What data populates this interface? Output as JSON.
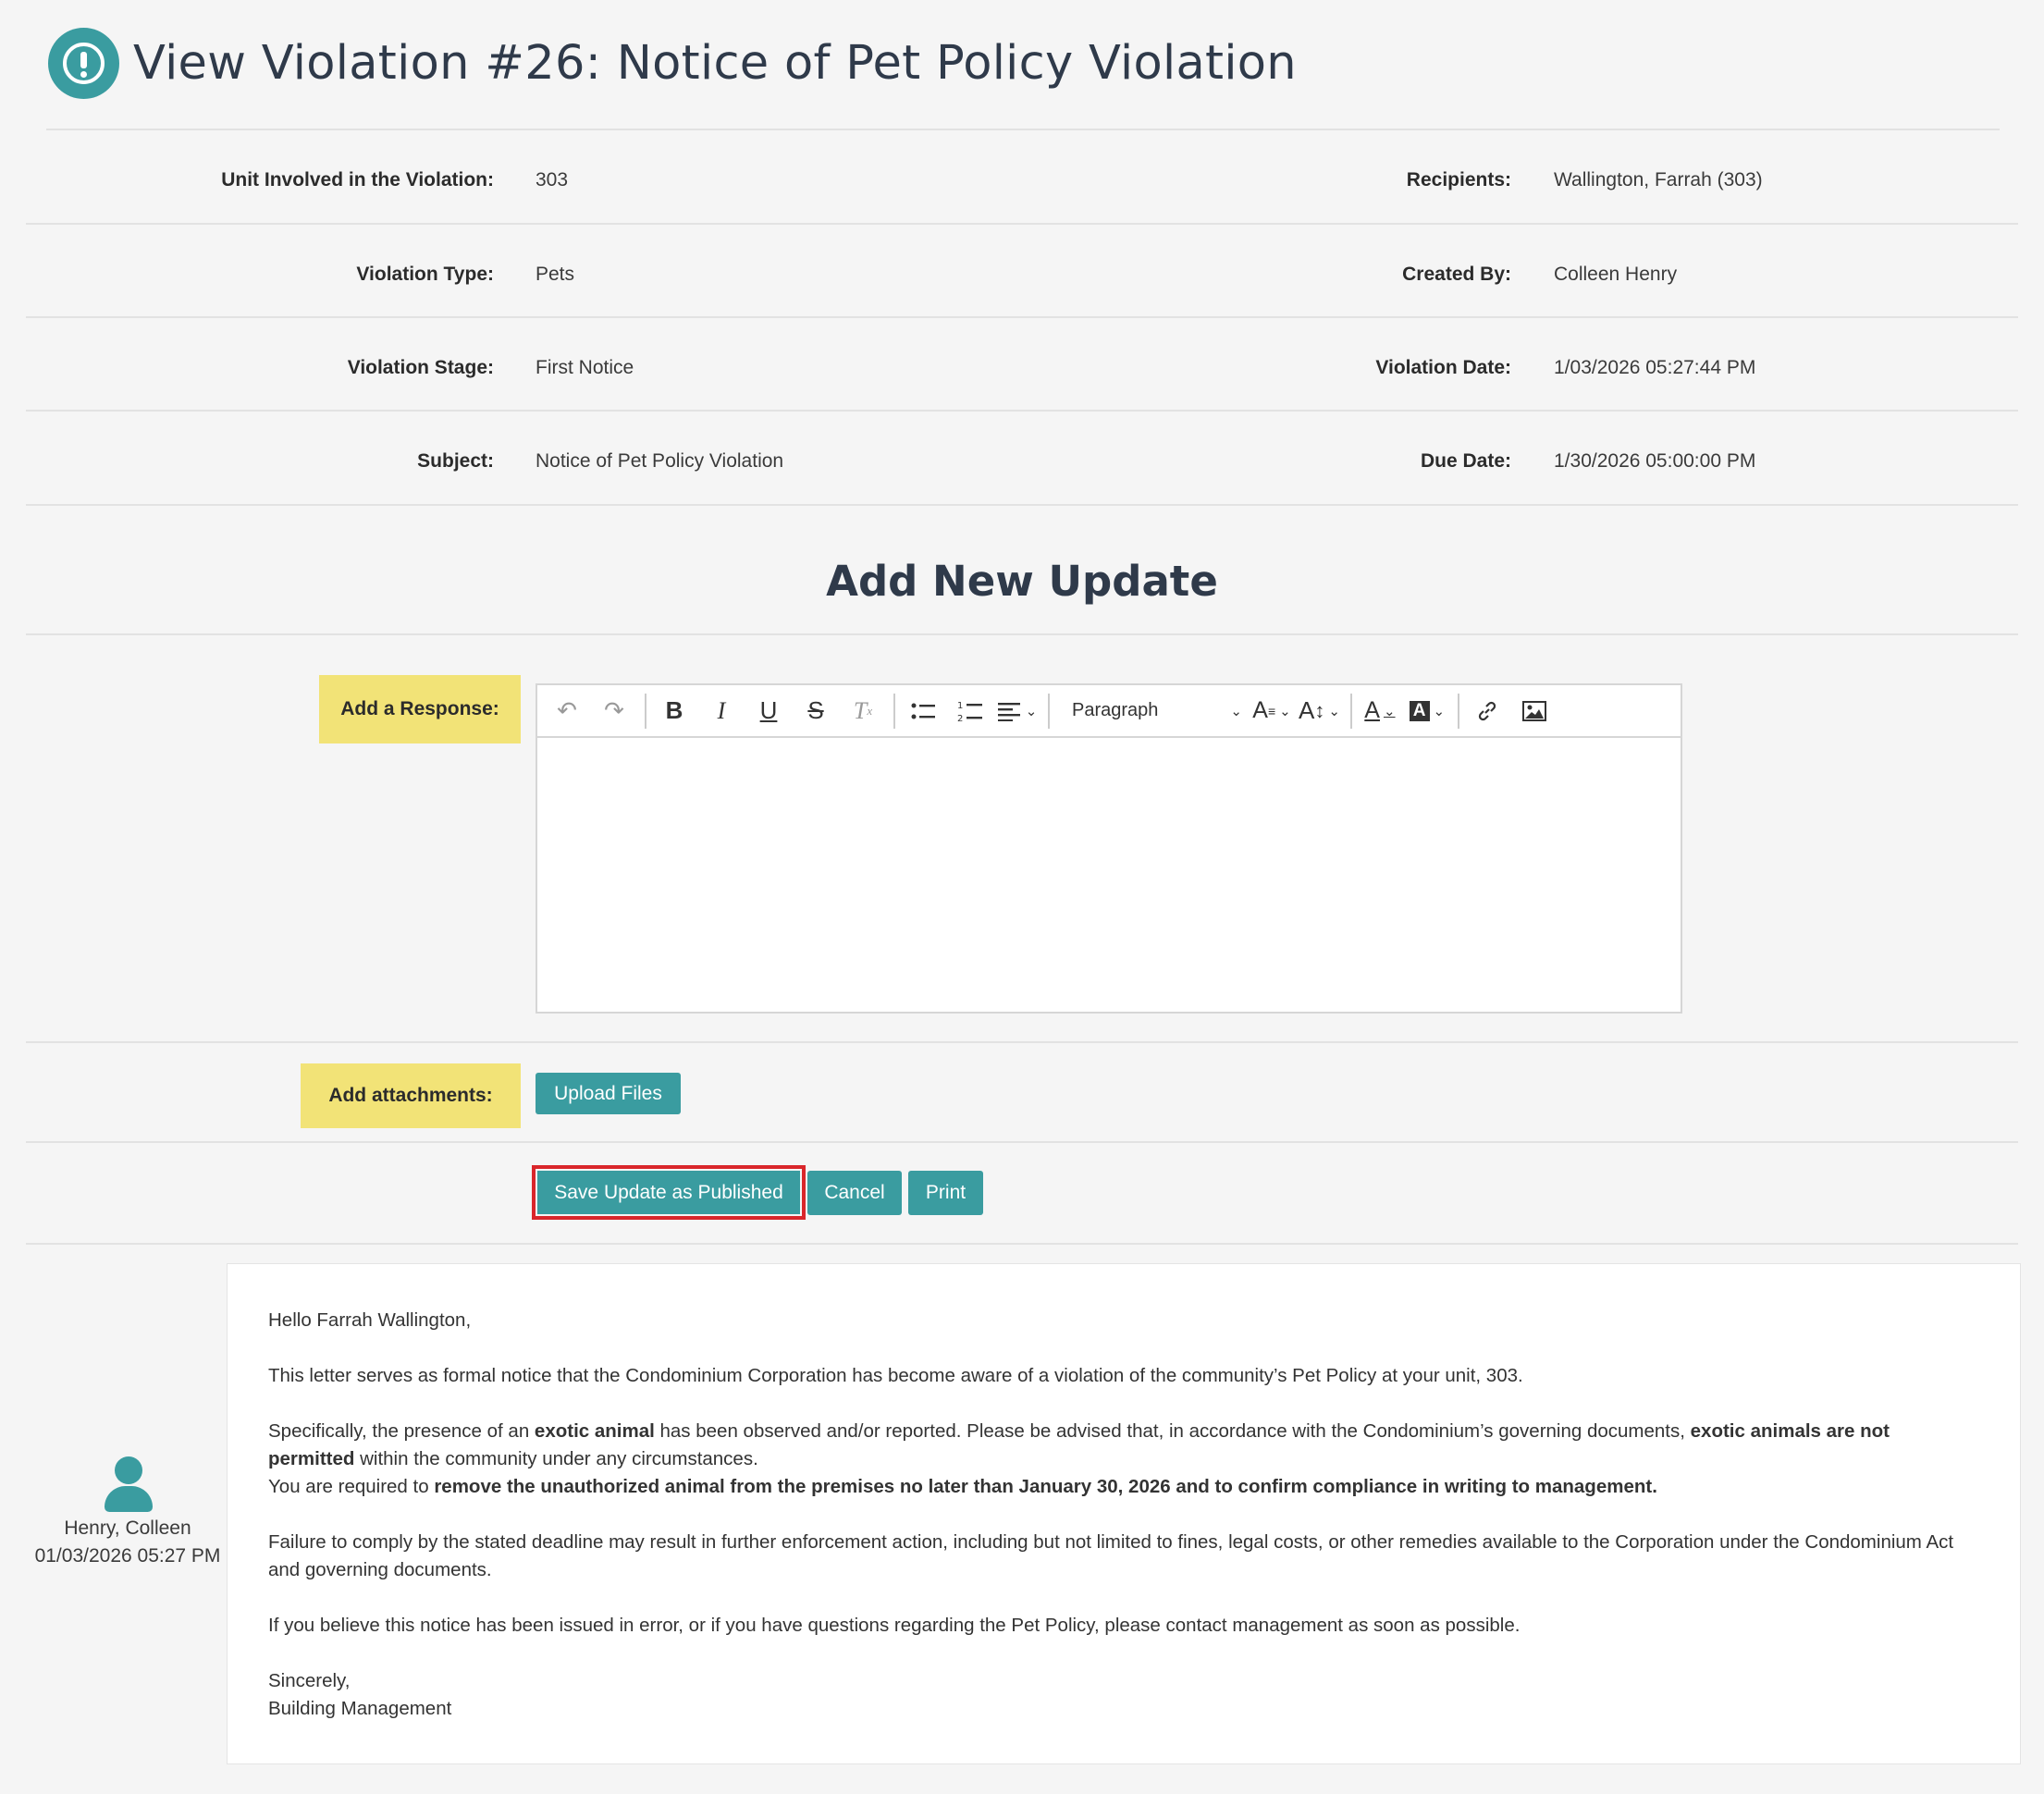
{
  "header": {
    "icon": "alert-circle-icon",
    "title": "View Violation #26: Notice of Pet Policy Violation"
  },
  "details": {
    "unit_label": "Unit Involved in the Violation:",
    "unit_value": "303",
    "recipients_label": "Recipients:",
    "recipients_value": "Wallington, Farrah (303)",
    "type_label": "Violation Type:",
    "type_value": "Pets",
    "created_by_label": "Created By:",
    "created_by_value": "Colleen Henry",
    "stage_label": "Violation Stage:",
    "stage_value": "First Notice",
    "violation_date_label": "Violation Date:",
    "violation_date_value": "1/03/2026 05:27:44 PM",
    "subject_label": "Subject:",
    "subject_value": "Notice of Pet Policy Violation",
    "due_date_label": "Due Date:",
    "due_date_value": "1/30/2026 05:00:00 PM"
  },
  "update_form": {
    "section_title": "Add New Update",
    "response_label": "Add a Response:",
    "editor": {
      "paragraph_select": "Paragraph",
      "toolbar_icons": [
        "undo-icon",
        "redo-icon",
        "bold-icon",
        "italic-icon",
        "underline-icon",
        "strikethrough-icon",
        "remove-format-icon",
        "bulleted-list-icon",
        "numbered-list-icon",
        "align-icon",
        "font-family-icon",
        "font-size-icon",
        "font-color-icon",
        "font-background-icon",
        "link-icon",
        "image-icon"
      ],
      "content": ""
    },
    "attachments_label": "Add attachments:",
    "upload_button": "Upload Files",
    "save_button": "Save Update as Published",
    "cancel_button": "Cancel",
    "print_button": "Print"
  },
  "history": {
    "author": "Henry, Colleen",
    "timestamp": "01/03/2026 05:27 PM",
    "message": {
      "greeting": "Hello Farrah Wallington,",
      "p1": "This letter serves as formal notice that the Condominium Corporation has become aware of a violation of the community’s Pet Policy at your unit, 303.",
      "p2_a": "Specifically, the presence of an ",
      "p2_b": "exotic animal",
      "p2_c": " has been observed and/or reported. Please be advised that, in accordance with the Condominium’s governing documents, ",
      "p2_d": "exotic animals are not permitted",
      "p2_e": " within the community under any circumstances.",
      "p3_a": "You are required to ",
      "p3_b": "remove the unauthorized animal from the premises no later than January 30, 2026 and to confirm compliance in writing to management.",
      "p4": "Failure to comply by the stated deadline may result in further enforcement action, including but not limited to fines, legal costs, or other remedies available to the Corporation under the Condominium Act and governing documents.",
      "p5": "If you believe this notice has been issued in error, or if you have questions regarding the Pet Policy, please contact management as soon as possible.",
      "closing": "Sincerely,",
      "signature": "Building Management"
    }
  },
  "colors": {
    "accent": "#3a9ca0",
    "label_highlight": "#f2e377",
    "focus_outline": "#d9262b",
    "background": "#f5f5f5"
  }
}
